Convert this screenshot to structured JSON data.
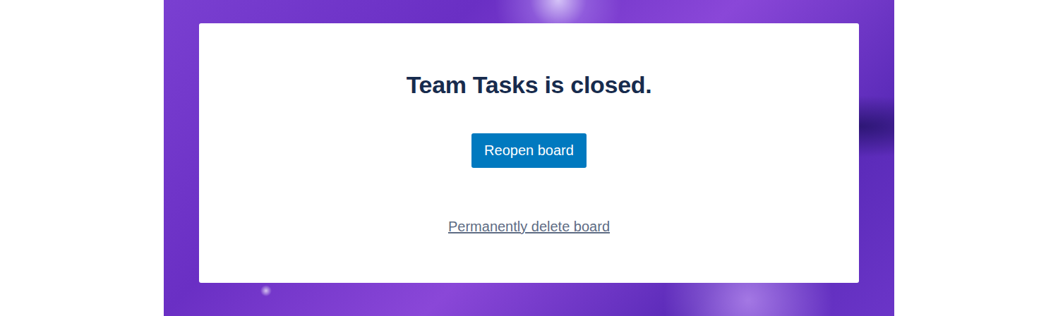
{
  "board": {
    "closed_message": "Team Tasks is closed."
  },
  "buttons": {
    "reopen": "Reopen board",
    "delete": "Permanently delete board"
  }
}
